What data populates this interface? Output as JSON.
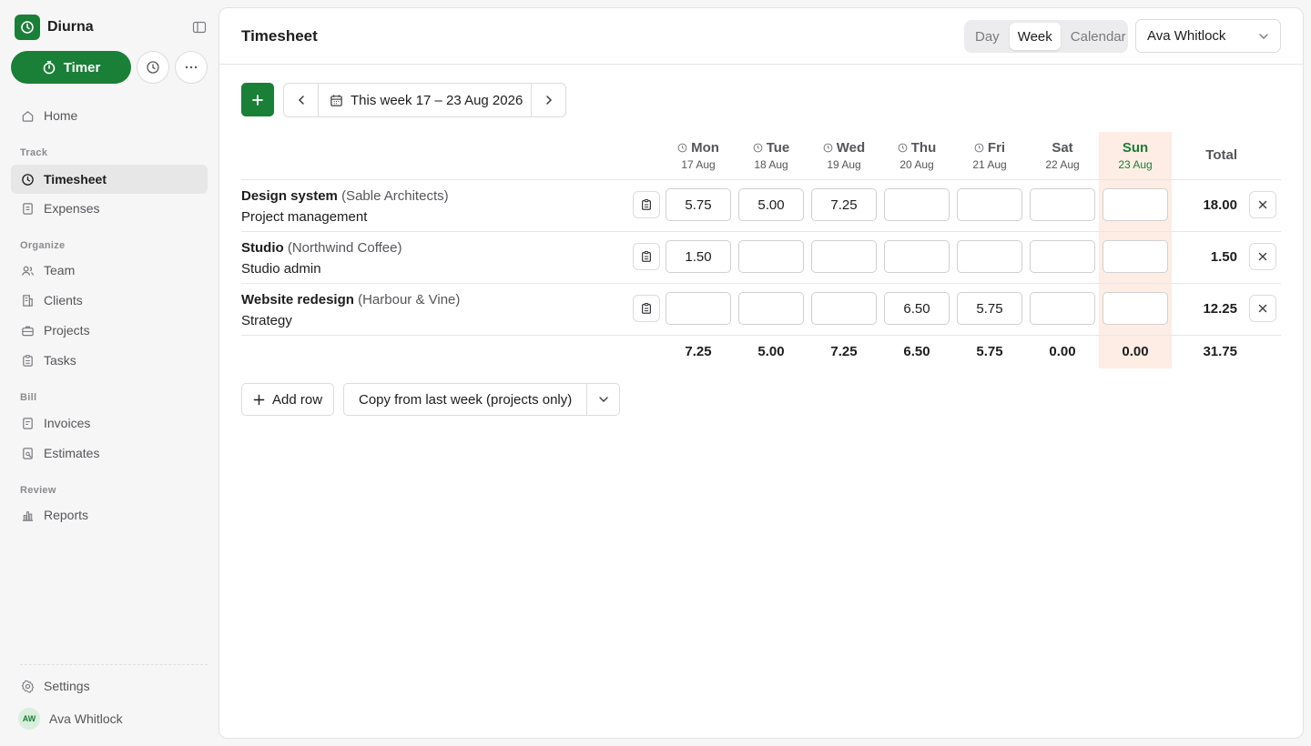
{
  "app": {
    "name": "Diurna"
  },
  "sidebar": {
    "timer_label": "Timer",
    "nav": {
      "home": "Home",
      "groups": {
        "track": "Track",
        "organize": "Organize",
        "bill": "Bill",
        "review": "Review"
      },
      "timesheet": "Timesheet",
      "expenses": "Expenses",
      "team": "Team",
      "clients": "Clients",
      "projects": "Projects",
      "tasks": "Tasks",
      "invoices": "Invoices",
      "estimates": "Estimates",
      "reports": "Reports",
      "settings": "Settings"
    },
    "user": {
      "initials": "AW",
      "name": "Ava Whitlock"
    }
  },
  "header": {
    "title": "Timesheet",
    "view_tabs": [
      "Day",
      "Week",
      "Calendar"
    ],
    "active_view": "Week",
    "user_select": "Ava Whitlock"
  },
  "toolbar": {
    "week_label": "This week 17 – 23 Aug 2026"
  },
  "grid": {
    "days": [
      {
        "name": "Mon",
        "date": "17 Aug"
      },
      {
        "name": "Tue",
        "date": "18 Aug"
      },
      {
        "name": "Wed",
        "date": "19 Aug"
      },
      {
        "name": "Thu",
        "date": "20 Aug"
      },
      {
        "name": "Fri",
        "date": "21 Aug"
      },
      {
        "name": "Sat",
        "date": "22 Aug"
      },
      {
        "name": "Sun",
        "date": "23 Aug"
      }
    ],
    "total_label": "Total",
    "rows": [
      {
        "project": "Design system",
        "client": "(Sable Architects)",
        "task": "Project management",
        "hours": [
          "5.75",
          "5.00",
          "7.25",
          "",
          "",
          "",
          ""
        ],
        "total": "18.00"
      },
      {
        "project": "Studio",
        "client": "(Northwind Coffee)",
        "task": "Studio admin",
        "hours": [
          "1.50",
          "",
          "",
          "",
          "",
          "",
          ""
        ],
        "total": "1.50"
      },
      {
        "project": "Website redesign",
        "client": "(Harbour & Vine)",
        "task": "Strategy",
        "hours": [
          "",
          "",
          "",
          "6.50",
          "5.75",
          "",
          ""
        ],
        "total": "12.25"
      }
    ],
    "day_totals": [
      "7.25",
      "5.00",
      "7.25",
      "6.50",
      "5.75",
      "0.00",
      "0.00"
    ],
    "grand_total": "31.75"
  },
  "footer": {
    "add_row_label": "Add row",
    "copy_label": "Copy from last week (projects only)"
  },
  "colors": {
    "accent": "#1a7f37",
    "today_bg": "#fdede5"
  }
}
